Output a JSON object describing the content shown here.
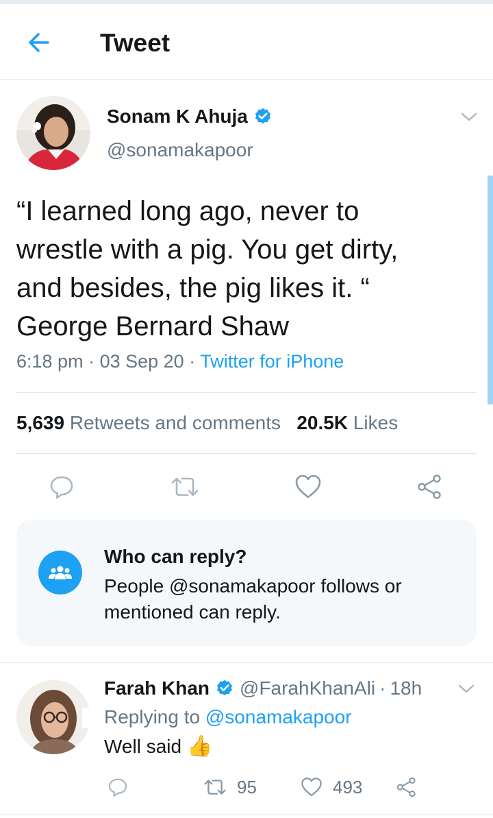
{
  "header": {
    "title": "Tweet"
  },
  "tweet": {
    "author_name": "Sonam K Ahuja",
    "author_handle": "@sonamakapoor",
    "text": "“I learned long ago, never to\nwrestle with a pig. You get dirty,\nand besides, the pig likes it. “\nGeorge Bernard Shaw",
    "time": "6:18 pm",
    "date": "03 Sep 20",
    "source": "Twitter for iPhone",
    "retweets_count": "5,639",
    "retweets_label": "Retweets and comments",
    "likes_count": "20.5K",
    "likes_label": "Likes"
  },
  "who_can_reply": {
    "title": "Who can reply?",
    "body": "People @sonamakapoor follows or mentioned can reply."
  },
  "reply": {
    "author_name": "Farah Khan",
    "author_handle": "@FarahKhanAli",
    "age": "18h",
    "replying_prefix": "Replying to",
    "replying_to": "@sonamakapoor",
    "text": "Well said",
    "retweets": "95",
    "likes": "493"
  },
  "colors": {
    "accent": "#1da1f2",
    "secondary_text": "#657786",
    "primary_text": "#14171a",
    "card_bg": "#f5f8fa",
    "divider": "#e1e8ed"
  },
  "icons": {
    "back": "arrow-left-icon",
    "verified": "verified-badge-icon",
    "caret": "chevron-down-icon",
    "reply": "comment-icon",
    "retweet": "retweet-icon",
    "like": "heart-icon",
    "share": "share-icon",
    "group": "group-icon",
    "emoji": "thumbs-up-emoji"
  }
}
